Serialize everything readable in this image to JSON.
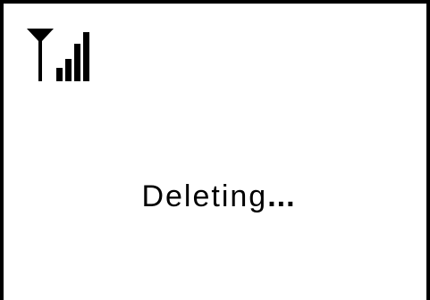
{
  "status": {
    "signal_icon": "signal-strength-icon",
    "signal_bars": 4,
    "message": "Deleting",
    "ellipsis": "..."
  },
  "colors": {
    "background": "#ffffff",
    "foreground": "#000000"
  }
}
